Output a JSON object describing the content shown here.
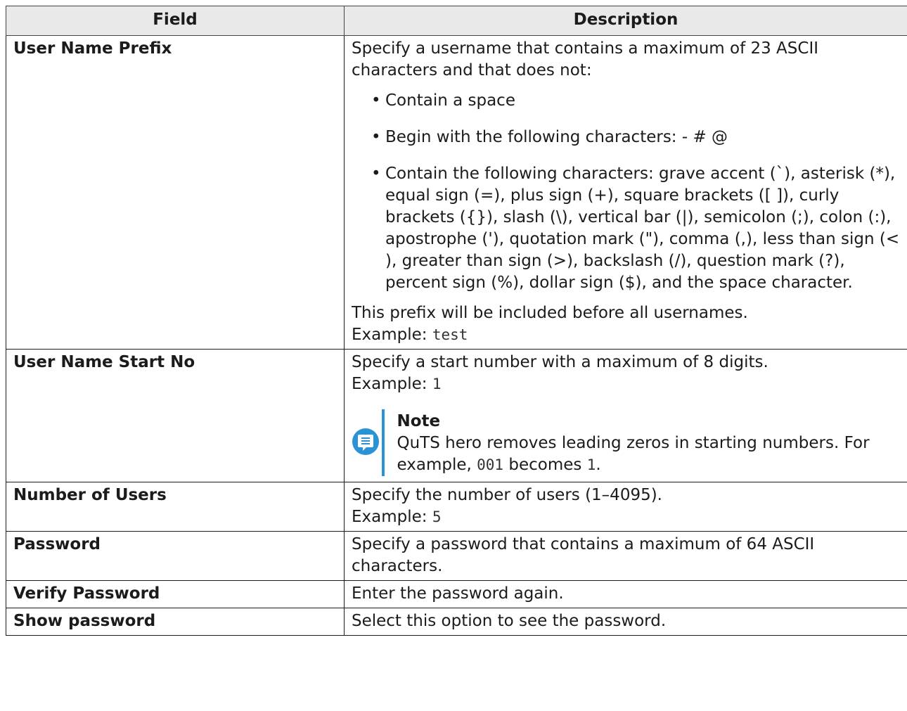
{
  "header": {
    "field": "Field",
    "description": "Description"
  },
  "rows": [
    {
      "field": "User Name Prefix",
      "intro": "Specify a username that contains a maximum of 23 ASCII characters and that does not:",
      "bullets": [
        "Contain a space",
        "Begin with the following characters: - # @",
        "Contain the following characters: grave accent (`), asterisk (*), equal sign (=), plus sign (+), square brackets ([ ]), curly brackets ({}), slash (\\), vertical bar (|), semicolon (;), colon (:), apostrophe ('), quotation mark (\"), comma (,), less than sign (< ), greater than sign (>), backslash (/), question mark (?), percent sign (%), dollar sign ($), and the space character."
      ],
      "outro": "This prefix will be included before all usernames.",
      "example_label": "Example:",
      "example_value": "test"
    },
    {
      "field": "User Name Start No",
      "text": "Specify a start number with a maximum of 8 digits.",
      "example_label": "Example:",
      "example_value": "1",
      "note": {
        "title": "Note",
        "text_before": "QuTS hero removes leading zeros in starting numbers. For example,",
        "code1": "001",
        "text_mid": "becomes",
        "code2": "1",
        "text_after": "."
      }
    },
    {
      "field": "Number of Users",
      "text": "Specify the number of users (1–4095).",
      "example_label": "Example:",
      "example_value": "5"
    },
    {
      "field": "Password",
      "text": "Specify a password that contains a maximum of 64 ASCII characters."
    },
    {
      "field": "Verify Password",
      "text": "Enter the password again."
    },
    {
      "field": "Show password",
      "text": "Select this option to see the password."
    }
  ],
  "colors": {
    "header_bg": "#e9e9e9",
    "note_accent": "#2a93d5",
    "border": "#1b1b1b"
  },
  "icons": {
    "note": "note-icon",
    "bullet": "bullet-icon"
  }
}
